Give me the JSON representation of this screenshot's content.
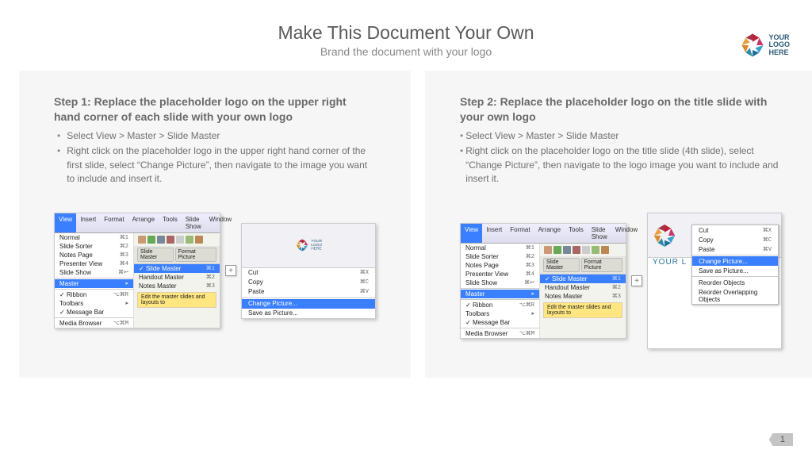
{
  "title": "Make This Document Your Own",
  "subtitle": "Brand the document with your logo",
  "logo_text_1": "YOUR",
  "logo_text_2": "LOGO",
  "logo_text_3": "HERE",
  "step1": {
    "head": "Step 1: Replace the placeholder logo on the upper right hand corner of each slide with your own logo",
    "b1": "Select View > Master > Slide Master",
    "b2": "Right click on the placeholder logo in the upper right hand corner of the first slide, select “Change Picture”, then navigate to the image you want to include and insert it."
  },
  "step2": {
    "head": "Step 2: Replace the placeholder logo on the title slide with your own logo",
    "b1": "Select View > Master > Slide Master",
    "b2": "Right click on the placeholder logo on the title slide (4th slide), select “Change Picture”, then navigate to the logo image you want to include and insert it."
  },
  "menu": {
    "bar": [
      "View",
      "Insert",
      "Format",
      "Arrange",
      "Tools",
      "Slide Show",
      "Window"
    ],
    "left": [
      {
        "t": "Normal",
        "s": "⌘1"
      },
      {
        "t": "Slide Sorter",
        "s": "⌘2"
      },
      {
        "t": "Notes Page",
        "s": "⌘3"
      },
      {
        "t": "Presenter View",
        "s": "⌘4"
      },
      {
        "t": "Slide Show",
        "s": "⌘↩"
      }
    ],
    "master": "Master",
    "left2": [
      {
        "t": "Ribbon",
        "s": "⌥⌘R",
        "c": true
      },
      {
        "t": "Toolbars",
        "s": "▸"
      },
      {
        "t": "Message Bar",
        "s": "",
        "c": true
      }
    ],
    "media": "Media Browser",
    "media_sc": "⌥⌘M",
    "subhead": [
      "Slide Master",
      "Format Picture"
    ],
    "right_items": [
      {
        "t": "Slide Master",
        "s": "⌘1",
        "sel": true
      },
      {
        "t": "Handout Master",
        "s": "⌘2"
      },
      {
        "t": "Notes Master",
        "s": "⌘3"
      }
    ],
    "tip": "Edit the master slides and layouts to"
  },
  "ctx1": {
    "items": [
      {
        "t": "Cut",
        "s": "⌘X"
      },
      {
        "t": "Copy",
        "s": "⌘C"
      },
      {
        "t": "Paste",
        "s": "⌘V"
      }
    ],
    "sep": true,
    "change": "Change Picture...",
    "after": [
      {
        "t": "Save as Picture...",
        "s": ""
      }
    ]
  },
  "ctx2": {
    "items": [
      {
        "t": "Cut",
        "s": "⌘X"
      },
      {
        "t": "Copy",
        "s": "⌘C"
      },
      {
        "t": "Paste",
        "s": "⌘V"
      }
    ],
    "change": "Change Picture...",
    "after": [
      {
        "t": "Save as Picture...",
        "s": ""
      },
      {
        "t": "Reorder Objects",
        "s": ""
      },
      {
        "t": "Reorder Overlapping Objects",
        "s": ""
      }
    ]
  },
  "big_label": "YOUR L",
  "page": "1"
}
